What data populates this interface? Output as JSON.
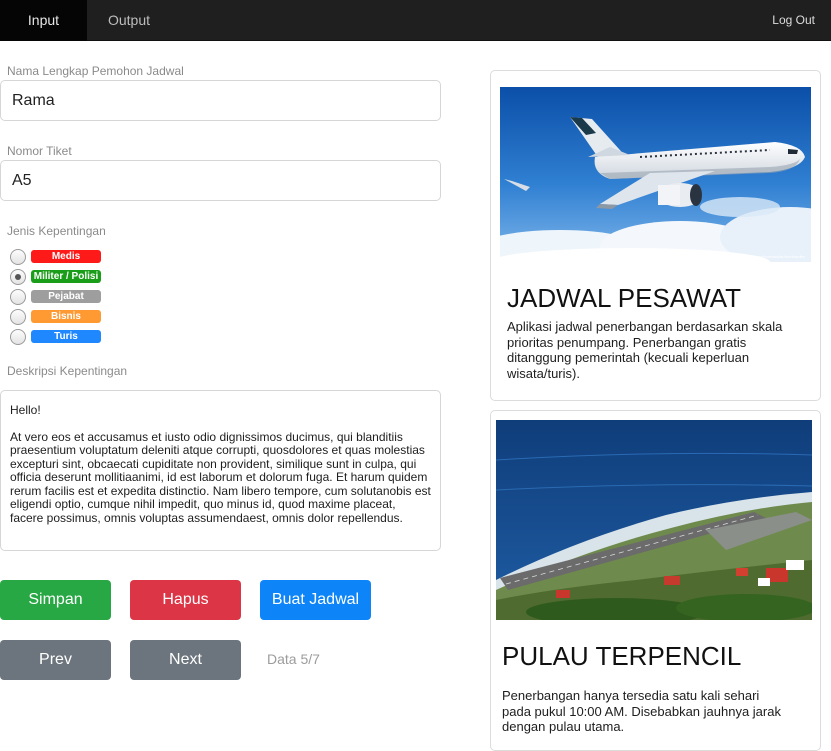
{
  "nav": {
    "tabs": [
      "Input",
      "Output"
    ],
    "logout": "Log Out"
  },
  "form": {
    "name_label": "Nama Lengkap Pemohon Jadwal",
    "name_value": "Rama",
    "ticket_label": "Nomor Tiket",
    "ticket_value": "A5",
    "interest_label": "Jenis Kepentingan",
    "interests": [
      {
        "label": "Medis",
        "color": "#ff1a1a",
        "checked": false
      },
      {
        "label": "Militer / Polisi",
        "color": "#1a9e1a",
        "checked": true
      },
      {
        "label": "Pejabat",
        "color": "#9e9e9e",
        "checked": false
      },
      {
        "label": "Bisnis",
        "color": "#ff9a33",
        "checked": false
      },
      {
        "label": "Turis",
        "color": "#1f88ff",
        "checked": false
      }
    ],
    "desc_label": "Deskripsi Kepentingan",
    "desc_greeting": "Hello!",
    "desc_body": "At vero eos et accusamus et iusto odio dignissimos ducimus, qui blanditiis praesentium voluptatum deleniti atque corrupti, quosdolores et quas molestias excepturi sint, obcaecati cupiditate non provident, similique sunt in culpa, qui officia deserunt mollitiaanimi, id est laborum et dolorum fuga. Et harum quidem rerum facilis est et expedita distinctio. Nam libero tempore, cum solutanobis est eligendi optio, cumque nihil impedit, quo minus id, quod maxime placeat, facere possimus, omnis voluptas assumendaest, omnis dolor repellendus."
  },
  "buttons": {
    "save": "Simpan",
    "delete": "Hapus",
    "create": "Buat Jadwal",
    "prev": "Prev",
    "next": "Next"
  },
  "colors": {
    "save": "#28a745",
    "delete": "#dc3545",
    "create": "#0d85f8",
    "nav_btn": "#6c757d"
  },
  "status": "Data 5/7",
  "cards": [
    {
      "title": "JADWAL PESAWAT",
      "text": "Aplikasi jadwal penerbangan berdasarkan skala prioritas penumpang. Penerbangan gratis ditanggung pemerintah (kecuali keperluan wisata/turis).",
      "image_credit": "© pictures/bombardier/bombardier"
    },
    {
      "title": "PULAU TERPENCIL",
      "text": "Penerbangan hanya tersedia satu kali sehari pada pukul 10:00 AM. Disebabkan jauhnya jarak dengan pulau utama."
    }
  ]
}
